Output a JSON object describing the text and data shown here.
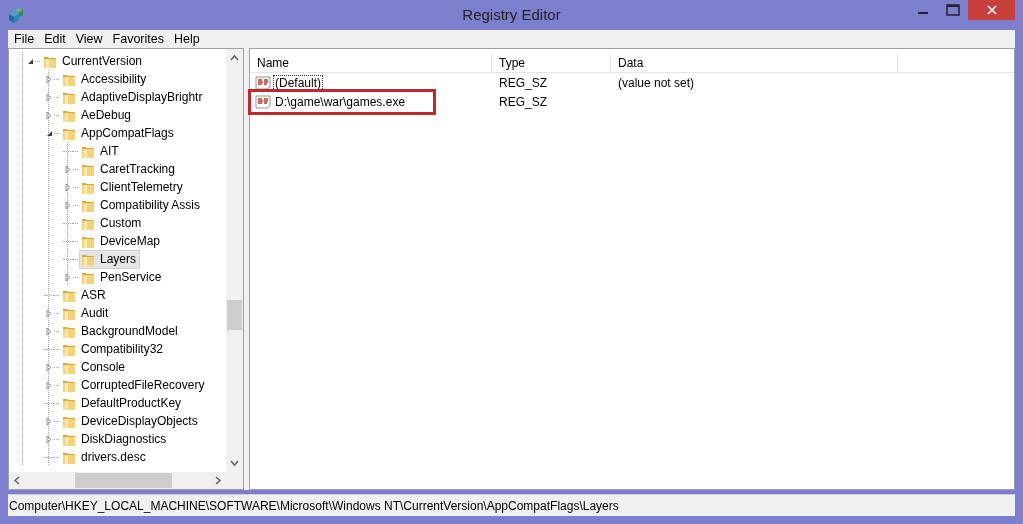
{
  "window": {
    "title": "Registry Editor"
  },
  "menu": [
    "File",
    "Edit",
    "View",
    "Favorites",
    "Help"
  ],
  "tree": [
    {
      "label": "CurrentVersion",
      "expandable": true,
      "expanded": true,
      "selected": false,
      "children": [
        {
          "label": "Accessibility",
          "expandable": true,
          "expanded": false,
          "selected": false
        },
        {
          "label": "AdaptiveDisplayBrightr",
          "expandable": true,
          "expanded": false,
          "selected": false
        },
        {
          "label": "AeDebug",
          "expandable": true,
          "expanded": false,
          "selected": false
        },
        {
          "label": "AppCompatFlags",
          "expandable": true,
          "expanded": true,
          "selected": false,
          "children": [
            {
              "label": "AIT",
              "expandable": false,
              "expanded": false,
              "selected": false
            },
            {
              "label": "CaretTracking",
              "expandable": true,
              "expanded": false,
              "selected": false
            },
            {
              "label": "ClientTelemetry",
              "expandable": true,
              "expanded": false,
              "selected": false
            },
            {
              "label": "Compatibility Assis",
              "expandable": true,
              "expanded": false,
              "selected": false
            },
            {
              "label": "Custom",
              "expandable": false,
              "expanded": false,
              "selected": false
            },
            {
              "label": "DeviceMap",
              "expandable": false,
              "expanded": false,
              "selected": false
            },
            {
              "label": "Layers",
              "expandable": false,
              "expanded": false,
              "selected": true
            },
            {
              "label": "PenService",
              "expandable": true,
              "expanded": false,
              "selected": false
            }
          ]
        },
        {
          "label": "ASR",
          "expandable": false,
          "expanded": false,
          "selected": false
        },
        {
          "label": "Audit",
          "expandable": true,
          "expanded": false,
          "selected": false
        },
        {
          "label": "BackgroundModel",
          "expandable": true,
          "expanded": false,
          "selected": false
        },
        {
          "label": "Compatibility32",
          "expandable": false,
          "expanded": false,
          "selected": false
        },
        {
          "label": "Console",
          "expandable": true,
          "expanded": false,
          "selected": false
        },
        {
          "label": "CorruptedFileRecovery",
          "expandable": true,
          "expanded": false,
          "selected": false
        },
        {
          "label": "DefaultProductKey",
          "expandable": false,
          "expanded": false,
          "selected": false
        },
        {
          "label": "DeviceDisplayObjects",
          "expandable": true,
          "expanded": false,
          "selected": false
        },
        {
          "label": "DiskDiagnostics",
          "expandable": true,
          "expanded": false,
          "selected": false
        },
        {
          "label": "drivers.desc",
          "expandable": false,
          "expanded": false,
          "selected": false
        }
      ]
    }
  ],
  "values": {
    "columns": [
      "Name",
      "Type",
      "Data"
    ],
    "rows": [
      {
        "name": "(Default)",
        "type": "REG_SZ",
        "data": "(value not set)",
        "focused": true,
        "highlighted": false
      },
      {
        "name": "D:\\game\\war\\games.exe",
        "type": "REG_SZ",
        "focused": false,
        "highlighted": true
      }
    ]
  },
  "status_bar": "Computer\\HKEY_LOCAL_MACHINE\\SOFTWARE\\Microsoft\\Windows NT\\CurrentVersion\\AppCompatFlags\\Layers"
}
